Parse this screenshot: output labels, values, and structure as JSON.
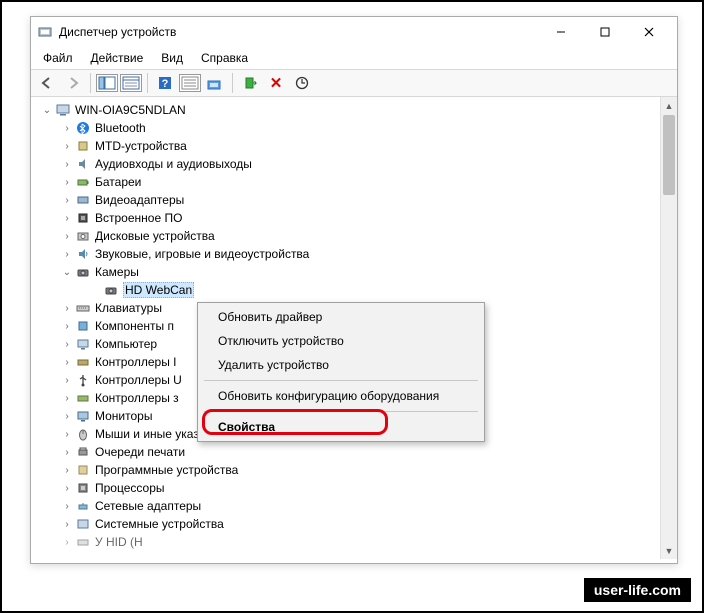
{
  "window": {
    "title": "Диспетчер устройств"
  },
  "menu": {
    "file": "Файл",
    "action": "Действие",
    "view": "Вид",
    "help": "Справка"
  },
  "tree": {
    "root": "WIN-OIA9C5NDLAN",
    "bluetooth": "Bluetooth",
    "mtd": "MTD-устройства",
    "audio": "Аудиовходы и аудиовыходы",
    "batteries": "Батареи",
    "video_adapters": "Видеоадаптеры",
    "firmware": "Встроенное ПО",
    "disks": "Дисковые устройства",
    "sound": "Звуковые, игровые и видеоустройства",
    "cameras": "Камеры",
    "webcam": "HD WebCan",
    "keyboards": "Клавиатуры",
    "components": "Компоненты п",
    "computer": "Компьютер",
    "ctrl_ide": "Контроллеры I",
    "ctrl_usb": "Контроллеры U",
    "ctrl_stor": "Контроллеры з",
    "monitors": "Мониторы",
    "mice": "Мыши и иные указывающие устройства",
    "print_queues": "Очереди печати",
    "software": "Программные устройства",
    "cpus": "Процессоры",
    "network": "Сетевые адаптеры",
    "system": "Системные устройства",
    "hid_cut": "У                       HID (H"
  },
  "context_menu": {
    "update_driver": "Обновить драйвер",
    "disable": "Отключить устройство",
    "uninstall": "Удалить устройство",
    "scan": "Обновить конфигурацию оборудования",
    "properties": "Свойства"
  },
  "watermark": "user-life.com"
}
